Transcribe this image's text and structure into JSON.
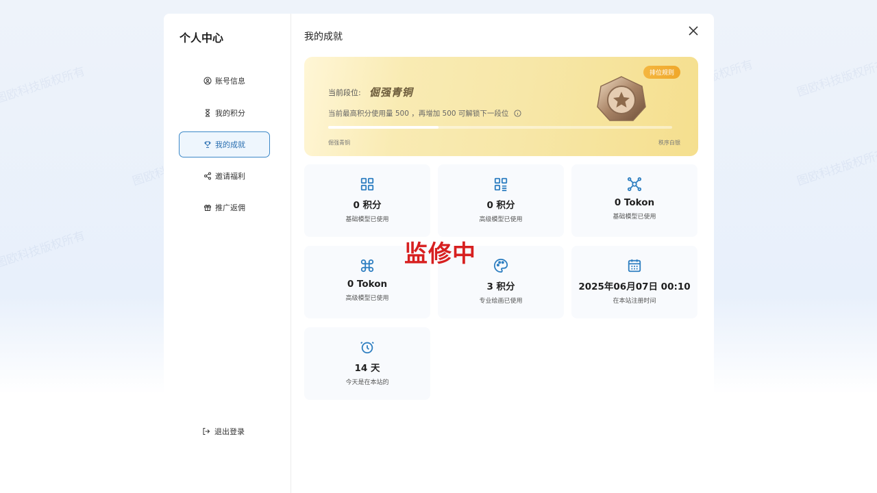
{
  "sidebar": {
    "title": "个人中心",
    "items": [
      {
        "label": "账号信息"
      },
      {
        "label": "我的积分"
      },
      {
        "label": "我的成就"
      },
      {
        "label": "邀请福利"
      },
      {
        "label": "推广返佣"
      }
    ],
    "logout_label": "退出登录"
  },
  "main": {
    "title": "我的成就",
    "rank": {
      "rules_label": "排位规则",
      "current_prefix": "当前段位:",
      "current_name": "倔强青铜",
      "description": "当前最高积分使用量 500 ，再增加 500 可解锁下一段位",
      "progress": 0.32,
      "current_label": "倔强青铜",
      "next_label": "秩序白银"
    },
    "stats": [
      {
        "value": "0 积分",
        "label": "基础模型已使用",
        "icon": "grid-icon"
      },
      {
        "value": "0 积分",
        "label": "高级模型已使用",
        "icon": "grid-list-icon"
      },
      {
        "value": "0 Tokon",
        "label": "基础模型已使用",
        "icon": "network-icon"
      },
      {
        "value": "0 Tokon",
        "label": "高级模型已使用",
        "icon": "command-icon"
      },
      {
        "value": "3 积分",
        "label": "专业绘画已使用",
        "icon": "palette-icon"
      },
      {
        "value": "2025年06月07日 00:10",
        "label": "在本站注册时间",
        "icon": "calendar-icon"
      },
      {
        "value": "14 天",
        "label": "今天是在本站的",
        "icon": "alarm-clock-icon"
      }
    ]
  },
  "overlay": {
    "repair_text": "监修中",
    "watermark": "图欧科技版权所有"
  },
  "colors": {
    "accent": "#3a87c7",
    "icon_blue": "#2f7fc1",
    "rank_badge": "#f0ab30",
    "repair_red": "#d72020"
  }
}
